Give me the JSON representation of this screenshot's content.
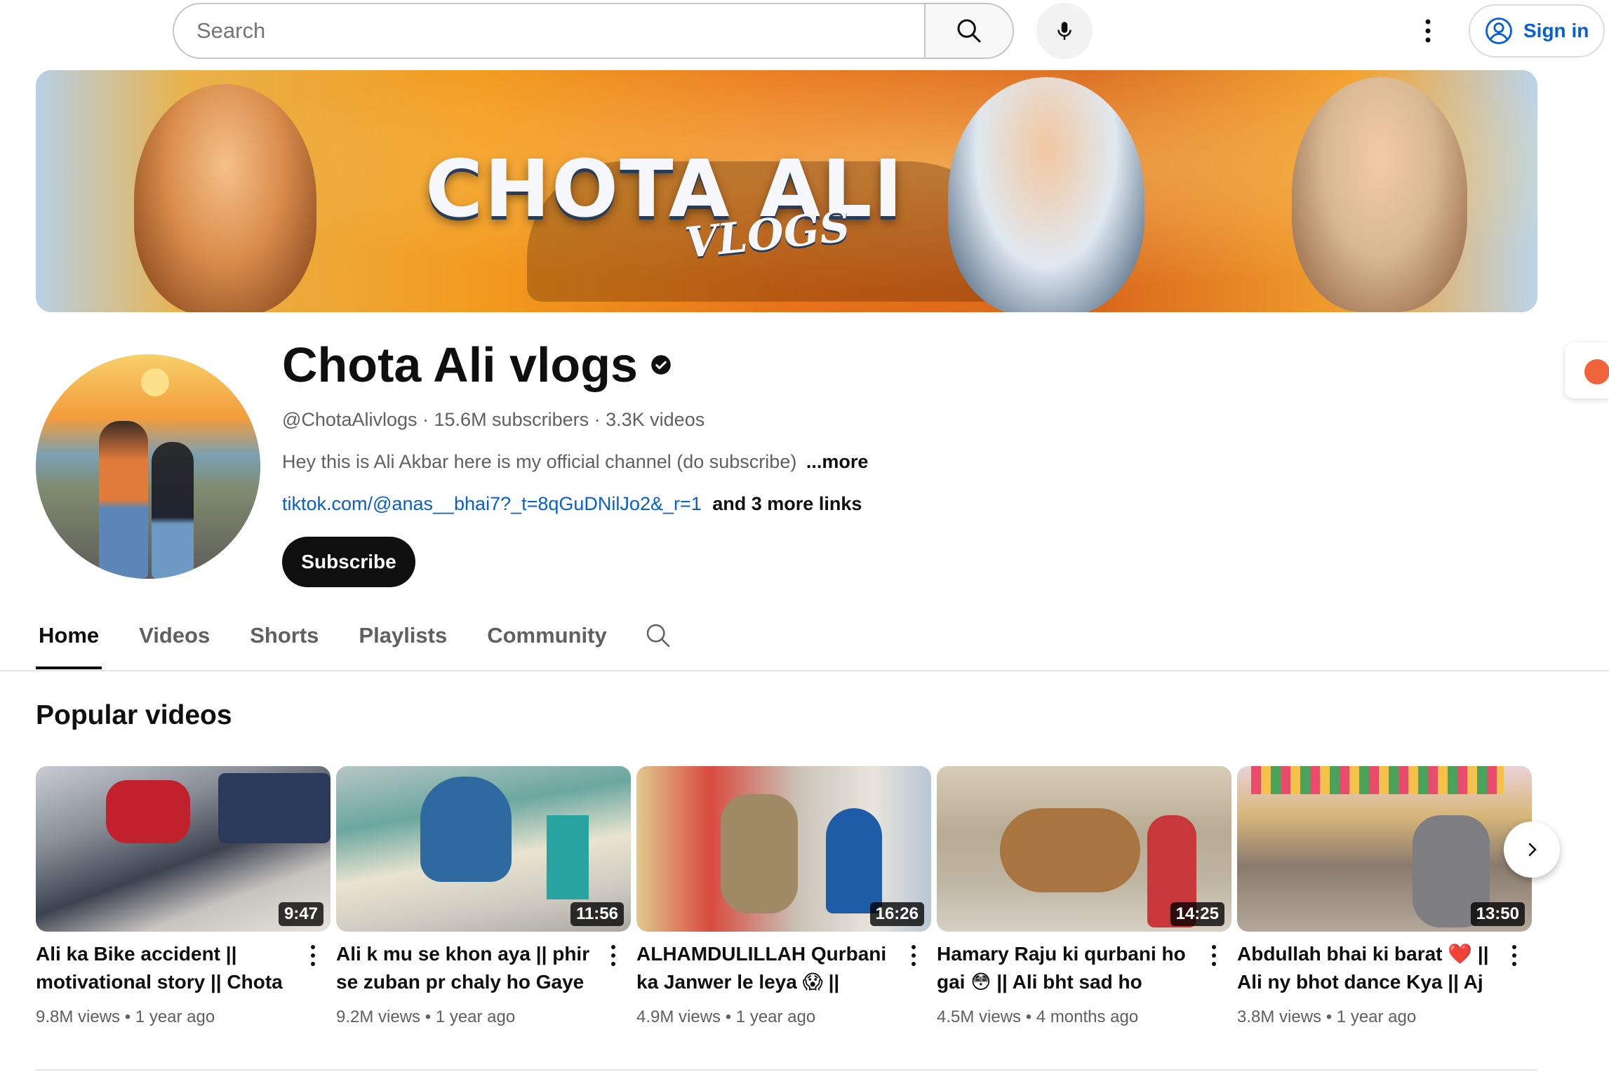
{
  "search": {
    "placeholder": "Search"
  },
  "header": {
    "signin_label": "Sign in"
  },
  "banner": {
    "title": "CHOTA ALI",
    "subtitle": "VLOGS"
  },
  "channel": {
    "name": "Chota Ali vlogs",
    "handle": "@ChotaAlivlogs",
    "subscribers": "15.6M subscribers",
    "videos": "3.3K videos",
    "description": "Hey this is Ali Akbar here is my official channel (do subscribe)",
    "more_label": "...more",
    "link": "tiktok.com/@anas__bhai7?_t=8qGuDNilJo2&_r=1",
    "more_links": "and 3 more links",
    "subscribe_label": "Subscribe"
  },
  "tabs": [
    {
      "label": "Home",
      "active": true
    },
    {
      "label": "Videos",
      "active": false
    },
    {
      "label": "Shorts",
      "active": false
    },
    {
      "label": "Playlists",
      "active": false
    },
    {
      "label": "Community",
      "active": false
    }
  ],
  "section": {
    "title": "Popular videos"
  },
  "videos": [
    {
      "title": "Ali ka Bike accident || motivational story || Chota …",
      "duration": "9:47",
      "views": "9.8M views",
      "age": "1 year ago"
    },
    {
      "title": "Ali k mu se khon aya || phir se zuban pr chaly ho Gaye 🥺",
      "duration": "11:56",
      "views": "9.2M views",
      "age": "1 year ago"
    },
    {
      "title": "ALHAMDULILLAH Qurbani ka Janwer le leya 😱 ||",
      "duration": "16:26",
      "views": "4.9M views",
      "age": "1 year ago"
    },
    {
      "title": "Hamary Raju ki qurbani ho gai 😳 || Ali bht sad ho gaya…",
      "duration": "14:25",
      "views": "4.5M views",
      "age": "4 months ago"
    },
    {
      "title": "Abdullah bhai ki barat ❤️ || Ali ny bhot dance Kya || Aj to…",
      "duration": "13:50",
      "views": "3.8M views",
      "age": "1 year ago"
    }
  ],
  "colors": {
    "link": "#065fd4",
    "text": "#0f0f0f",
    "secondary": "#606060",
    "subscribe_bg": "#0f0f0f"
  }
}
